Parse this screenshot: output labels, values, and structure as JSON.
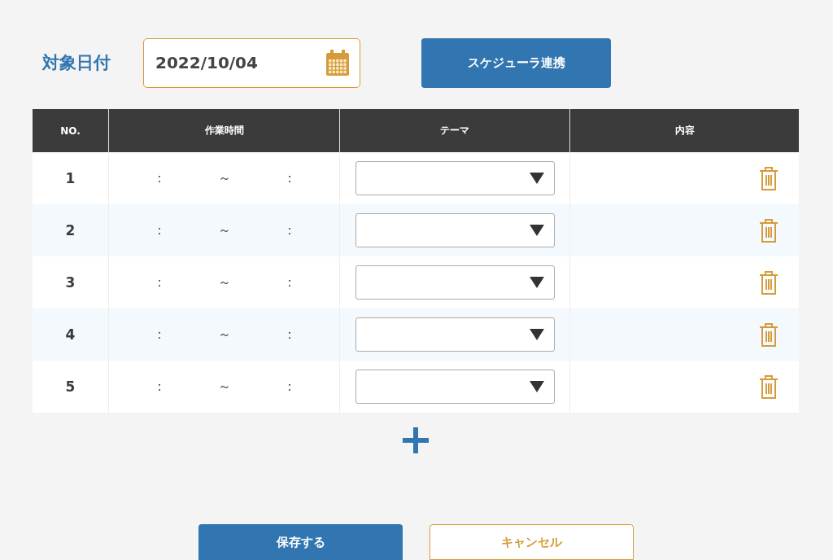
{
  "date_label": "対象日付",
  "date_field": {
    "value": "2022/10/04"
  },
  "scheduler_button": "スケジューラ連携",
  "table": {
    "columns": [
      "NO.",
      "作業時間",
      "テーマ",
      "内容"
    ],
    "rows": [
      {
        "no": "1",
        "start_sep": "：",
        "tilde": "～",
        "end_sep": "："
      },
      {
        "no": "2",
        "start_sep": "：",
        "tilde": "～",
        "end_sep": "："
      },
      {
        "no": "3",
        "start_sep": "：",
        "tilde": "～",
        "end_sep": "："
      },
      {
        "no": "4",
        "start_sep": "：",
        "tilde": "～",
        "end_sep": "："
      },
      {
        "no": "5",
        "start_sep": "：",
        "tilde": "～",
        "end_sep": "："
      }
    ]
  },
  "buttons": [
    {
      "kind": "primary",
      "label": "保存する"
    },
    {
      "kind": "secondary",
      "label": "キャンセル"
    }
  ]
}
